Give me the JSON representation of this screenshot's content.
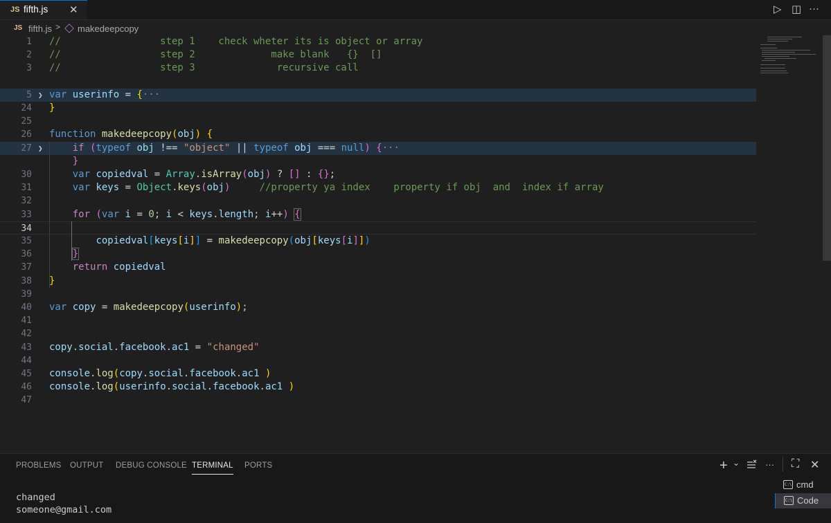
{
  "tab": {
    "label": "fifth.js",
    "badge": "JS",
    "close": "✕"
  },
  "breadcrumb": {
    "file": "fifth.js",
    "separator": ">",
    "symbol": "makedeepcopy"
  },
  "editor": {
    "lines": [
      {
        "n": "1",
        "html": "<span class='c'>//                 step 1    check wheter its is object or array</span>"
      },
      {
        "n": "2",
        "html": "<span class='c'>//                 step 2             make blank   {}  []</span>"
      },
      {
        "n": "3",
        "html": "<span class='c'>//                 step 3              recursive call</span>"
      },
      {
        "n": "",
        "html": ""
      },
      {
        "n": "5",
        "fold": true,
        "hl": true,
        "html": "<span class='k'>var</span> <span class='v'>userinfo</span> <span class='o'>=</span> <span class='b1'>{</span><span class='ell'>···</span>"
      },
      {
        "n": "24",
        "html": "<span class='b1'>}</span>"
      },
      {
        "n": "25",
        "html": ""
      },
      {
        "n": "26",
        "html": "<span class='k'>function</span> <span class='f'>makedeepcopy</span><span class='b1'>(</span><span class='v'>obj</span><span class='b1'>)</span> <span class='b1'>{</span>"
      },
      {
        "n": "27",
        "fold": true,
        "hl": true,
        "html": "    <span class='ctl'>if</span> <span class='b2'>(</span><span class='k'>typeof</span> <span class='v'>obj</span> <span class='o'>!==</span> <span class='s'>\"object\"</span> <span class='o'>||</span> <span class='k'>typeof</span> <span class='v'>obj</span> <span class='o'>===</span> <span class='k'>null</span><span class='b2'>)</span> <span class='b2'>{</span><span class='ell'>···</span>"
      },
      {
        "n": "",
        "html": "    <span class='b2'>}</span>"
      },
      {
        "n": "30",
        "html": "    <span class='k'>var</span> <span class='v'>copiedval</span> <span class='o'>=</span> <span class='t'>Array</span>.<span class='f'>isArray</span><span class='b2'>(</span><span class='v'>obj</span><span class='b2'>)</span> <span class='o'>?</span> <span class='b2'>[]</span> <span class='o'>:</span> <span class='b2'>{}</span>;"
      },
      {
        "n": "31",
        "html": "    <span class='k'>var</span> <span class='v'>keys</span> <span class='o'>=</span> <span class='t'>Object</span>.<span class='f'>keys</span><span class='b2'>(</span><span class='v'>obj</span><span class='b2'>)</span>     <span class='c'>//property ya index    property if obj  and  index if array</span>"
      },
      {
        "n": "32",
        "html": ""
      },
      {
        "n": "33",
        "html": "    <span class='ctl'>for</span> <span class='b2'>(</span><span class='k'>var</span> <span class='v'>i</span> <span class='o'>=</span> <span class='n'>0</span>; <span class='v'>i</span> <span class='o'>&lt;</span> <span class='v'>keys</span>.<span class='v'>length</span>; <span class='v'>i</span><span class='o'>++</span><span class='b2'>)</span> <span class='b2' style='outline:1px solid #666'>{</span>"
      },
      {
        "n": "34",
        "cur": true,
        "html": ""
      },
      {
        "n": "35",
        "html": "        <span class='v'>copiedval</span><span class='b3'>[</span><span class='v'>keys</span><span class='b1'>[</span><span class='v'>i</span><span class='b1'>]</span><span class='b3'>]</span> <span class='o'>=</span> <span class='f'>makedeepcopy</span><span class='b3'>(</span><span class='v'>obj</span><span class='b1'>[</span><span class='v'>keys</span><span class='b2'>[</span><span class='v'>i</span><span class='b2'>]</span><span class='b1'>]</span><span class='b3'>)</span>"
      },
      {
        "n": "36",
        "html": "    <span class='b2' style='outline:1px solid #666'>}</span>"
      },
      {
        "n": "37",
        "html": "    <span class='ctl'>return</span> <span class='v'>copiedval</span>"
      },
      {
        "n": "38",
        "html": "<span class='b1'>}</span>"
      },
      {
        "n": "39",
        "html": ""
      },
      {
        "n": "40",
        "html": "<span class='k'>var</span> <span class='v'>copy</span> <span class='o'>=</span> <span class='f'>makedeepcopy</span><span class='b1'>(</span><span class='v'>userinfo</span><span class='b1'>)</span>;"
      },
      {
        "n": "41",
        "html": ""
      },
      {
        "n": "42",
        "html": ""
      },
      {
        "n": "43",
        "html": "<span class='v'>copy</span>.<span class='v'>social</span>.<span class='v'>facebook</span>.<span class='v'>ac1</span> <span class='o'>=</span> <span class='s'>\"changed\"</span>"
      },
      {
        "n": "44",
        "html": ""
      },
      {
        "n": "45",
        "html": "<span class='v'>console</span>.<span class='f'>log</span><span class='b1'>(</span><span class='v'>copy</span>.<span class='v'>social</span>.<span class='v'>facebook</span>.<span class='v'>ac1</span> <span class='b1'>)</span>"
      },
      {
        "n": "46",
        "html": "<span class='v'>console</span>.<span class='f'>log</span><span class='b1'>(</span><span class='v'>userinfo</span>.<span class='v'>social</span>.<span class='v'>facebook</span>.<span class='v'>ac1</span> <span class='b1'>)</span>"
      },
      {
        "n": "47",
        "html": ""
      }
    ]
  },
  "panel": {
    "tabs": [
      "PROBLEMS",
      "OUTPUT",
      "DEBUG CONSOLE",
      "TERMINAL",
      "PORTS"
    ],
    "active_tab": "TERMINAL",
    "terminal_output": [
      "changed",
      "someone@gmail.com"
    ],
    "terminals": [
      {
        "label": "cmd",
        "icon": "C:\\",
        "selected": false
      },
      {
        "label": "Code",
        "icon": "C:\\",
        "selected": true
      }
    ],
    "icons": {
      "add": "+",
      "dropdown": "⌄",
      "more": "···",
      "maximize": "⛶",
      "close": "✕"
    }
  },
  "toolbar": {
    "run": "▷",
    "split": "◫",
    "more": "···"
  }
}
